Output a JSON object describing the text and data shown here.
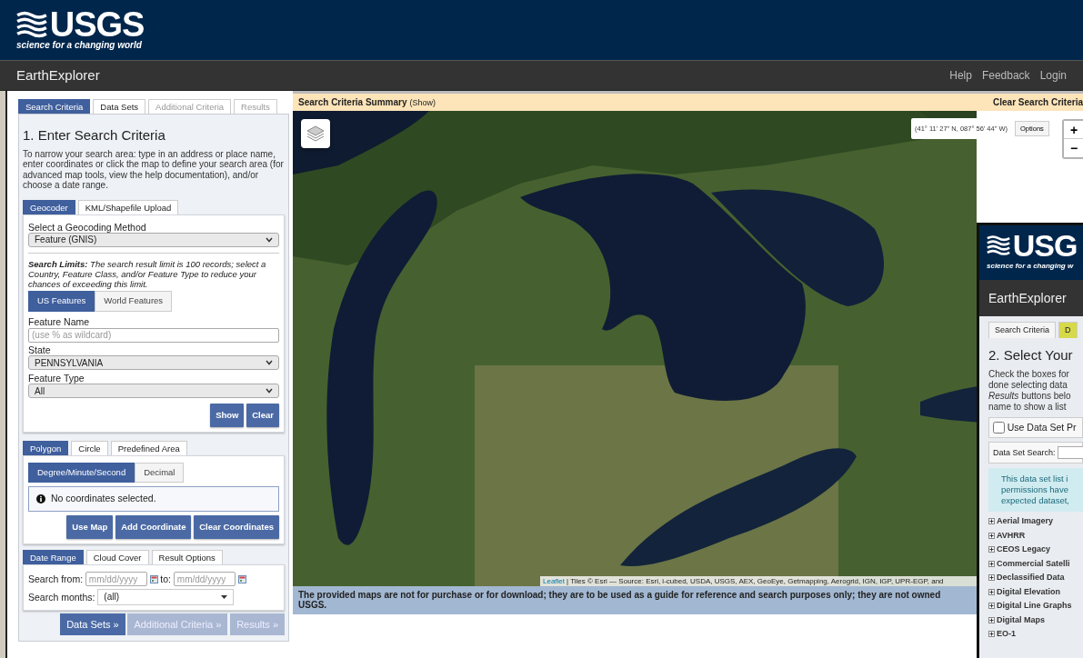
{
  "header": {
    "logo": "USGS",
    "tagline": "science for a changing world"
  },
  "navbar": {
    "title": "EarthExplorer",
    "links": [
      "Help",
      "Feedback",
      "Login"
    ]
  },
  "main_tabs": [
    {
      "label": "Search Criteria",
      "selected": true,
      "disabled": false
    },
    {
      "label": "Data Sets",
      "selected": false,
      "disabled": false
    },
    {
      "label": "Additional Criteria",
      "selected": false,
      "disabled": true
    },
    {
      "label": "Results",
      "selected": false,
      "disabled": true
    }
  ],
  "heading": "1. Enter Search Criteria",
  "intro": {
    "before": "To narrow your search area: type in an address or place name, enter coordinates or click the map to define your search area (for advanced map tools, view the",
    "link": "help documentation",
    "after": "), and/or choose a date range."
  },
  "location_tabs": [
    {
      "label": "Geocoder",
      "selected": true
    },
    {
      "label": "KML/Shapefile Upload",
      "selected": false
    }
  ],
  "geocoder": {
    "method_label": "Select a Geocoding Method",
    "method_value": "Feature (GNIS)",
    "limits": "**Search Limits:** The search result limit is 100 records; select a Country, Feature Class, and/or Feature Type to reduce your chances of exceeding this limit.",
    "feature_tabs": [
      {
        "label": "US Features",
        "selected": true
      },
      {
        "label": "World Features",
        "selected": false
      }
    ],
    "fields": [
      {
        "kind": "text",
        "label": "Feature Name",
        "placeholder": "(use % as wildcard)"
      },
      {
        "kind": "select",
        "label": "State",
        "value": "PENNSYLVANIA"
      },
      {
        "kind": "select",
        "label": "Feature Type",
        "value": "All"
      }
    ],
    "buttons": [
      "Show",
      "Clear"
    ]
  },
  "area_tabs": [
    {
      "label": "Polygon",
      "selected": true
    },
    {
      "label": "Circle",
      "selected": false
    },
    {
      "label": "Predefined Area",
      "selected": false
    }
  ],
  "coord_format_tabs": [
    {
      "label": "Degree/Minute/Second",
      "selected": true
    },
    {
      "label": "Decimal",
      "selected": false
    }
  ],
  "coord_message": "No coordinates selected.",
  "coord_buttons": [
    "Use Map",
    "Add Coordinate",
    "Clear Coordinates"
  ],
  "date_tabs": [
    {
      "label": "Date Range",
      "selected": true
    },
    {
      "label": "Cloud Cover",
      "selected": false
    },
    {
      "label": "Result Options",
      "selected": false
    }
  ],
  "date": {
    "from_label": "Search from:",
    "from_placeholder": "mm/dd/yyyy",
    "to_label": "to:",
    "to_placeholder": "mm/dd/yyyy",
    "months_label": "Search months:",
    "months_value": "(all)"
  },
  "nav_buttons": [
    {
      "label": "Data Sets »",
      "disabled": false
    },
    {
      "label": "Additional Criteria »",
      "disabled": true
    },
    {
      "label": "Results »",
      "disabled": true
    }
  ],
  "summary_bar": {
    "title": "Search Criteria Summary",
    "toggle": "(Show)",
    "clear": "Clear Search Criteria"
  },
  "map": {
    "coordinates": "(41° 11' 27\" N, 087° 56' 44\" W)",
    "options": "Options",
    "zoom_in": "+",
    "zoom_out": "−",
    "attribution_link": "Leaflet",
    "attribution": "| Tiles © Esri — Source: Esri, i-cubed, USDA, USGS, AEX, GeoEye, Getmapping, Aerogrid, IGN, IGP, UPR-EGP, and"
  },
  "disclaimer": "The provided maps are not for purchase or for download; they are to be used as a guide for reference and search purposes only; they are not owned USGS.",
  "overlay": {
    "logo": "USG",
    "tagline": "science for a changing w",
    "title": "EarthExplorer",
    "tabs": [
      {
        "label": "Search Criteria",
        "selected": false
      },
      {
        "label": "D",
        "selected": true
      }
    ],
    "heading": "2. Select Your",
    "intro_lines": [
      "Check the boxes for",
      "done selecting data",
      "*Results* buttons belo",
      "name to show a list"
    ],
    "checkbox": {
      "label": "Use Data Set Pr",
      "checked": false
    },
    "search_label": "Data Set Search:",
    "notice_lines": [
      "This data set list i",
      "permissions have",
      "expected dataset,"
    ],
    "categories": [
      {
        "label": "Aerial Imagery",
        "expanded": false
      },
      {
        "label": "AVHRR",
        "expanded": false
      },
      {
        "label": "CEOS Legacy",
        "expanded": false
      },
      {
        "label": "Commercial Satelli",
        "expanded": false
      },
      {
        "label": "Declassified Data",
        "expanded": false
      },
      {
        "label": "Digital Elevation",
        "expanded": false
      },
      {
        "label": "Digital Line Graphs",
        "expanded": false
      },
      {
        "label": "Digital Maps",
        "expanded": false
      },
      {
        "label": "EO-1",
        "expanded": false
      }
    ]
  }
}
